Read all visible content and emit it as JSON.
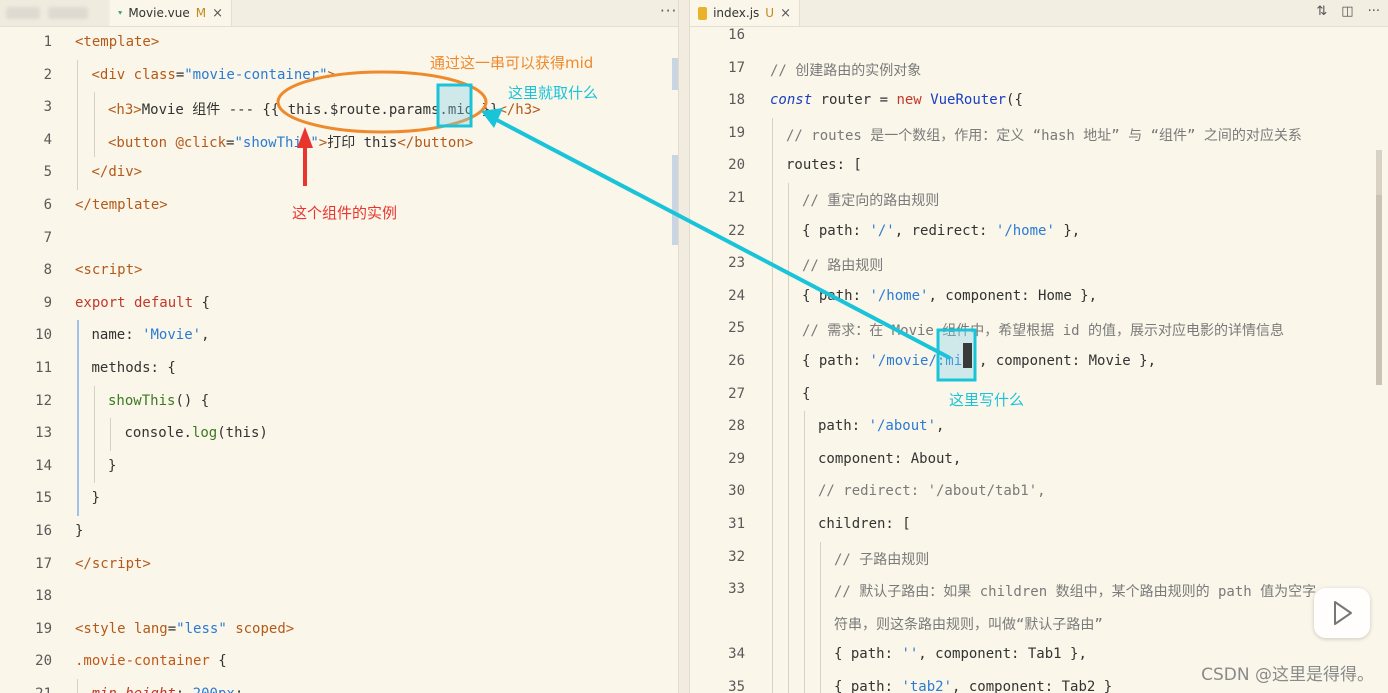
{
  "left_tab": {
    "name": "Movie.vue",
    "badge": "M",
    "close": "×",
    "icon": "vue-icon"
  },
  "right_tab": {
    "name": "index.js",
    "badge": "U",
    "close": "×",
    "icon": "js-file-icon"
  },
  "more_actions": "···",
  "toolbar": {
    "compare_icon": "⇅",
    "split_icon": "◫",
    "more": "···"
  },
  "left_code": [
    {
      "n": "1",
      "indent": 0,
      "html": "<span class='t-tag'>&lt;template&gt;</span>"
    },
    {
      "n": "2",
      "indent": 1,
      "html": "<span class='t-tag'>&lt;div</span> <span class='t-attr'>class</span>=<span class='t-str'>\"movie-container\"</span><span class='t-tag'>&gt;</span>"
    },
    {
      "n": "3",
      "indent": 2,
      "html": "<span class='t-tag'>&lt;h3&gt;</span>Movie 组件 --- {{ this.$route.params.mid }}<span class='t-tag'>&lt;/h3&gt;</span>"
    },
    {
      "n": "4",
      "indent": 2,
      "html": "<span class='t-tag'>&lt;button</span> <span class='t-attr'>@click</span>=<span class='t-str'>\"showThis\"</span><span class='t-tag'>&gt;</span>打印 this<span class='t-tag'>&lt;/button&gt;</span>"
    },
    {
      "n": "5",
      "indent": 1,
      "html": "<span class='t-tag'>&lt;/div&gt;</span>"
    },
    {
      "n": "6",
      "indent": 0,
      "html": "<span class='t-tag'>&lt;/template&gt;</span>"
    },
    {
      "n": "7",
      "indent": 0,
      "html": ""
    },
    {
      "n": "8",
      "indent": 0,
      "html": "<span class='t-tag'>&lt;script&gt;</span>"
    },
    {
      "n": "9",
      "indent": 0,
      "html": "<span class='t-kw'>export default</span> {"
    },
    {
      "n": "10",
      "indent": 1,
      "html": "name: <span class='t-str'>'Movie'</span>,"
    },
    {
      "n": "11",
      "indent": 1,
      "html": "methods: {"
    },
    {
      "n": "12",
      "indent": 2,
      "html": "<span class='t-fn'>showThis</span>() {"
    },
    {
      "n": "13",
      "indent": 3,
      "html": "console.<span class='t-fn'>log</span>(this)"
    },
    {
      "n": "14",
      "indent": 2,
      "html": "}"
    },
    {
      "n": "15",
      "indent": 1,
      "html": "}"
    },
    {
      "n": "16",
      "indent": 0,
      "html": "}"
    },
    {
      "n": "17",
      "indent": 0,
      "html": "<span class='t-tag'>&lt;/script&gt;</span>"
    },
    {
      "n": "18",
      "indent": 0,
      "html": ""
    },
    {
      "n": "19",
      "indent": 0,
      "html": "<span class='t-tag'>&lt;style</span> <span class='t-attr'>lang</span>=<span class='t-str'>\"less\"</span> <span class='t-attr'>scoped</span><span class='t-tag'>&gt;</span>"
    },
    {
      "n": "20",
      "indent": 0,
      "html": "<span class='t-sel'>.movie-container</span> {"
    },
    {
      "n": "21",
      "indent": 1,
      "html": "<span class='t-prop'>min-height</span>: <span class='t-str'>200px</span>;"
    }
  ],
  "right_code": [
    {
      "n": "16",
      "indent": 0,
      "html": ""
    },
    {
      "n": "17",
      "indent": 0,
      "html": "<span class='t-com'>// 创建路由的实例对象</span>"
    },
    {
      "n": "18",
      "indent": 0,
      "html": "<span class='t-kw2'>const</span> router = <span class='t-new'>new</span> <span class='t-cls'>VueRouter</span>({"
    },
    {
      "n": "19",
      "indent": 1,
      "html": "<span class='t-com'>// routes 是一个数组，作用：定义 “hash 地址” 与 “组件” 之间的对应关系</span>"
    },
    {
      "n": "20",
      "indent": 1,
      "html": "routes: ["
    },
    {
      "n": "21",
      "indent": 2,
      "html": "<span class='t-com'>// 重定向的路由规则</span>"
    },
    {
      "n": "22",
      "indent": 2,
      "html": "{ path: <span class='t-str'>'/'</span>, redirect: <span class='t-str'>'/home'</span> },"
    },
    {
      "n": "23",
      "indent": 2,
      "html": "<span class='t-com'>// 路由规则</span>"
    },
    {
      "n": "24",
      "indent": 2,
      "html": "{ path: <span class='t-str'>'/home'</span>, component: Home },"
    },
    {
      "n": "25",
      "indent": 2,
      "html": "<span class='t-com'>// 需求：在 Movie 组件中，希望根据 id 的值，展示对应电影的详情信息</span>"
    },
    {
      "n": "26",
      "indent": 2,
      "html": "{ path: <span class='t-str'>'/movie/:mid'</span>, component: Movie },"
    },
    {
      "n": "27",
      "indent": 2,
      "html": "{"
    },
    {
      "n": "28",
      "indent": 3,
      "html": "path: <span class='t-str'>'/about'</span>,"
    },
    {
      "n": "29",
      "indent": 3,
      "html": "component: About,"
    },
    {
      "n": "30",
      "indent": 3,
      "html": "<span class='t-com'>// redirect: '/about/tab1',</span>"
    },
    {
      "n": "31",
      "indent": 3,
      "html": "children: ["
    },
    {
      "n": "32",
      "indent": 4,
      "html": "<span class='t-com'>// 子路由规则</span>"
    },
    {
      "n": "33",
      "indent": 4,
      "html": "<span class='t-com'>// 默认子路由：如果 children 数组中，某个路由规则的 path 值为空字</span>"
    },
    {
      "n": "",
      "indent": 4,
      "html": "<span class='t-com'>符串，则这条路由规则，叫做“默认子路由”</span>"
    },
    {
      "n": "34",
      "indent": 4,
      "html": "{ path: <span class='t-str'>''</span>, component: Tab1 },"
    },
    {
      "n": "35",
      "indent": 4,
      "html": "{ path: <span class='t-str'>'tab2'</span>, component: Tab2 }"
    }
  ],
  "annotations": {
    "get_mid": "通过这一串可以获得mid",
    "take_here": "这里就取什么",
    "instance": "这个组件的实例",
    "write_here": "这里写什么"
  },
  "colors": {
    "orange": "#ef8a2c",
    "cyan": "#19c4d8",
    "red": "#e8362f"
  },
  "watermark": "CSDN @这里是得得。"
}
